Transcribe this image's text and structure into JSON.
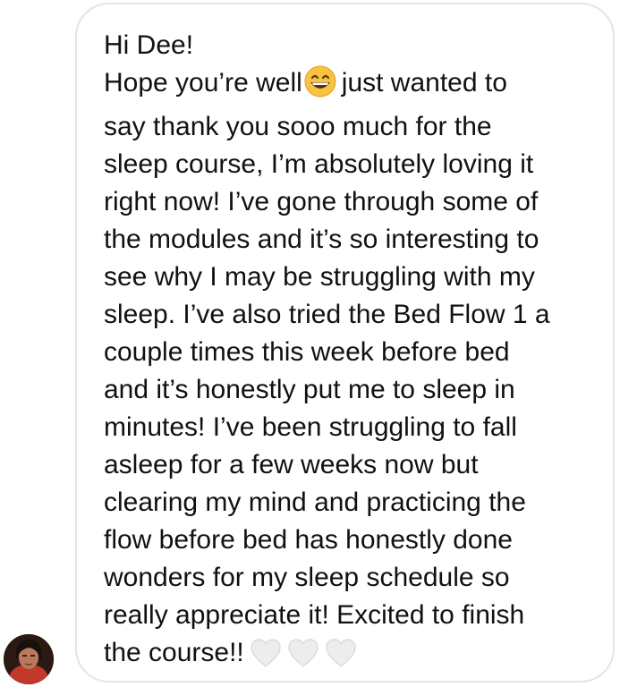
{
  "message": {
    "lines": [
      "Hi Dee!",
      "Hope you’re well",
      "just wanted to",
      "say thank you sooo much for the",
      "sleep course, I’m absolutely loving it",
      "right now! I’ve gone through some of",
      "the modules and it’s so interesting to",
      "see why I may be struggling with my",
      "sleep. I’ve also tried the Bed Flow 1 a",
      "couple times this week before bed",
      "and it’s honestly put me to sleep in",
      "minutes! I’ve been struggling to fall",
      "asleep for a few weeks now but",
      "clearing my mind and practicing the",
      "flow before bed has honestly done",
      "wonders for my sleep schedule so",
      "really appreciate it! Excited to finish",
      "the course!!"
    ],
    "emoji_icon": "grinning-face-with-smiling-eyes",
    "trailing_icons": [
      "white-heart",
      "white-heart",
      "white-heart"
    ]
  },
  "sender": {
    "avatar_icon": "profile-photo"
  },
  "colors": {
    "bubble_border": "#e4e4e4",
    "text": "#111111",
    "emoji_face": "#f7c340",
    "heart_fill": "#ededed"
  }
}
